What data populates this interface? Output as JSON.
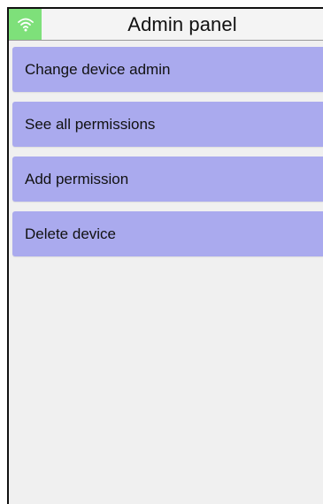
{
  "header": {
    "title": "Admin panel",
    "status_icon": "wifi-icon",
    "status_color": "#7ee07a"
  },
  "menu": {
    "items": [
      {
        "label": "Change device admin"
      },
      {
        "label": "See all permissions"
      },
      {
        "label": "Add permission"
      },
      {
        "label": "Delete device"
      }
    ],
    "item_color": "#aaaaee"
  }
}
